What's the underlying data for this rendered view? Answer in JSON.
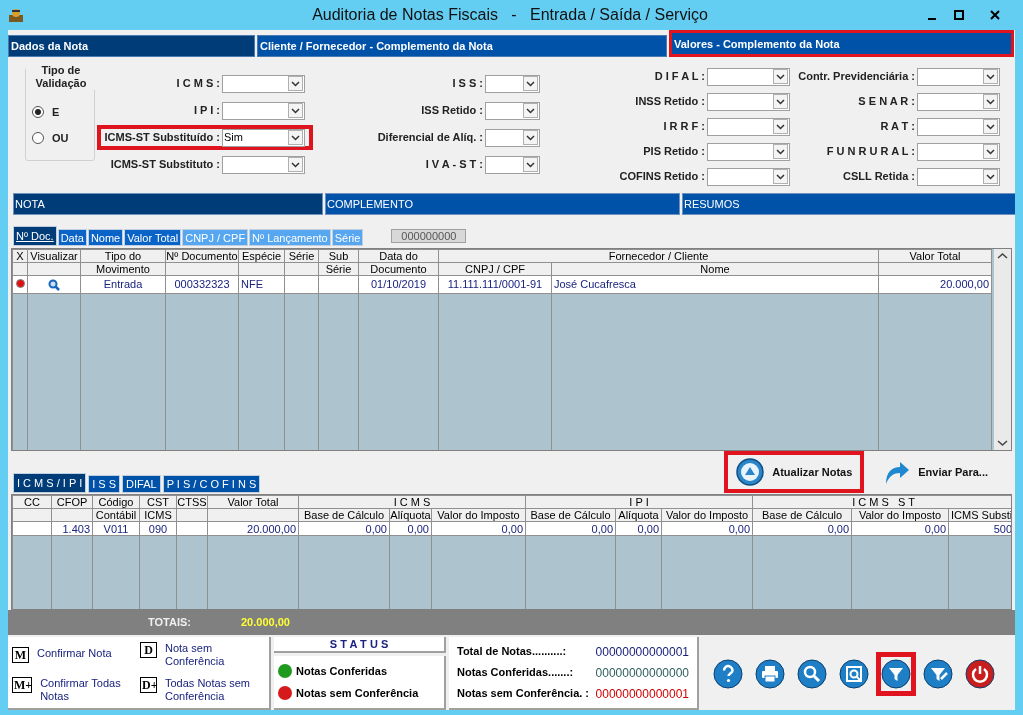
{
  "window": {
    "title": "Auditoria de Notas Fiscais   -   Entrada / Saída / Serviço"
  },
  "header_tabs": [
    {
      "label": "Dados da Nota",
      "selected": true,
      "highlighted": false
    },
    {
      "label": "Cliente / Fornecedor - Complemento da Nota",
      "selected": false,
      "highlighted": false
    },
    {
      "label": "Valores - Complemento da Nota",
      "selected": false,
      "highlighted": true
    }
  ],
  "validation": {
    "title": "Tipo de Validação",
    "options": [
      {
        "label": "E",
        "selected": true
      },
      {
        "label": "OU",
        "selected": false
      }
    ]
  },
  "filter_columns": [
    [
      {
        "label": "I C M S :"
      },
      {
        "label": "I P I :"
      },
      {
        "label": "ICMS-ST Substituído :",
        "value": "Sim",
        "highlighted": true
      },
      {
        "label": "ICMS-ST Substituto :"
      }
    ],
    [
      {
        "label": "I S S :"
      },
      {
        "label": "ISS Retido :"
      },
      {
        "label": "Diferencial de Alíq. :"
      },
      {
        "label": "I V A - S T :"
      }
    ],
    [
      {
        "label": "D I F A L :"
      },
      {
        "label": "INSS Retido :"
      },
      {
        "label": "I R R F :"
      },
      {
        "label": "PIS Retido :"
      },
      {
        "label": "COFINS Retido :"
      }
    ],
    [
      {
        "label": "Contr. Previdenciária :"
      },
      {
        "label": "S E N A R :"
      },
      {
        "label": "R A T :"
      },
      {
        "label": "F U N R U R A L :"
      },
      {
        "label": "CSLL Retida :"
      }
    ]
  ],
  "section_bar": [
    {
      "label": "NOTA",
      "selected": true
    },
    {
      "label": "COMPLEMENTO",
      "selected": false
    },
    {
      "label": "RESUMOS",
      "selected": false
    }
  ],
  "sort_tabs": [
    {
      "label": "Nº Doc.",
      "selected": true,
      "disabled": false
    },
    {
      "label": "Data",
      "selected": false,
      "disabled": false
    },
    {
      "label": "Nome",
      "selected": false,
      "disabled": false
    },
    {
      "label": "Valor Total",
      "selected": false,
      "disabled": false
    },
    {
      "label": "CNPJ / CPF",
      "selected": false,
      "disabled": true
    },
    {
      "label": "Nº Lançamento",
      "selected": false,
      "disabled": true
    },
    {
      "label": "Série",
      "selected": false,
      "disabled": true
    }
  ],
  "sort_search": {
    "value": "000000000"
  },
  "notes_table": {
    "columns": [
      {
        "top": "X"
      },
      {
        "top": "Visualizar"
      },
      {
        "top": "Tipo do",
        "bottom": "Movimento"
      },
      {
        "top": "Nº Documento"
      },
      {
        "top": "Espécie"
      },
      {
        "top": "Série"
      },
      {
        "top": "Sub",
        "bottom": "Série"
      },
      {
        "top": "Data do",
        "bottom": "Documento"
      },
      {
        "top": "Fornecedor / Cliente",
        "colspan": 2,
        "sub": [
          {
            "bottom": "CNPJ / CPF"
          },
          {
            "bottom": "Nome"
          }
        ]
      },
      {
        "top": "Valor Total"
      }
    ],
    "rows": [
      {
        "selected": true,
        "cells": [
          "",
          "",
          "Entrada",
          "000332323",
          "NFE",
          "",
          "",
          "01/10/2019",
          "11.111.111/0001-91",
          "José Cucafresca",
          "20.000,00"
        ]
      }
    ]
  },
  "detail_tabs": [
    {
      "label": "I C M S / I P I",
      "selected": true
    },
    {
      "label": "I S S",
      "selected": false
    },
    {
      "label": "DIFAL",
      "selected": false
    },
    {
      "label": "P I S / C O F I N S",
      "selected": false
    }
  ],
  "actions": [
    {
      "kind": "refresh",
      "label": "Atualizar Notas",
      "highlighted": true
    },
    {
      "kind": "send",
      "label": "Enviar Para...",
      "highlighted": false
    }
  ],
  "items_table": {
    "columns": [
      {
        "top": "CC"
      },
      {
        "top": "CFOP"
      },
      {
        "top": "Código",
        "bottom": "Contábil"
      },
      {
        "top": "CST",
        "bottom": "ICMS"
      },
      {
        "top": "CTSS"
      },
      {
        "top": "Valor Total"
      },
      {
        "top": "I C M S",
        "colspan": 3,
        "sub": [
          {
            "bottom": "Base de Cálculo"
          },
          {
            "bottom": "Alíquota"
          },
          {
            "bottom": "Valor do Imposto"
          }
        ]
      },
      {
        "top": "I P I",
        "colspan": 3,
        "sub": [
          {
            "bottom": "Base de Cálculo"
          },
          {
            "bottom": "Alíquota"
          },
          {
            "bottom": "Valor do Imposto"
          }
        ]
      },
      {
        "top": "I C M S   S T",
        "colspan": 3,
        "sub": [
          {
            "bottom": "Base de Cálculo"
          },
          {
            "bottom": "Valor do Imposto"
          },
          {
            "bottom": "ICMS Substi"
          }
        ]
      }
    ],
    "rows": [
      {
        "cells": [
          "",
          "1.403",
          "V011",
          "090",
          "",
          "20.000,00",
          "0,00",
          "0,00",
          "0,00",
          "0,00",
          "0,00",
          "0,00",
          "0,00",
          "0,00",
          "500"
        ]
      }
    ]
  },
  "totals": {
    "label": "TOTAIS:",
    "value": "20.000,00"
  },
  "legend": [
    {
      "key": "M",
      "label": "Confirmar Nota"
    },
    {
      "key": "D",
      "label": "Nota sem Conferência"
    },
    {
      "key": "M+",
      "label": "Confirmar Todas Notas"
    },
    {
      "key": "D+",
      "label": "Todas Notas sem Conferência"
    }
  ],
  "status": {
    "title": "S T A T U S",
    "items": [
      {
        "label": "Notas Conferidas",
        "color": "#1f9a1f"
      },
      {
        "label": "Notas sem Conferência",
        "color": "#d41a1a"
      }
    ]
  },
  "counts": [
    {
      "label": "Total de Notas..........:",
      "value": "00000000000001",
      "color": "#1a237e"
    },
    {
      "label": "Notas Conferidas.......:",
      "value": "00000000000000",
      "color": "#2f5f5f"
    },
    {
      "label": "Notas sem Conferência. :",
      "value": "00000000000001",
      "color": "#d40000"
    }
  ],
  "toolbar": [
    {
      "kind": "help",
      "highlighted": false
    },
    {
      "kind": "print",
      "highlighted": false
    },
    {
      "kind": "search",
      "highlighted": false
    },
    {
      "kind": "preview",
      "highlighted": false
    },
    {
      "kind": "filter",
      "highlighted": true
    },
    {
      "kind": "clear-filter",
      "highlighted": false
    },
    {
      "kind": "power",
      "highlighted": false
    }
  ]
}
